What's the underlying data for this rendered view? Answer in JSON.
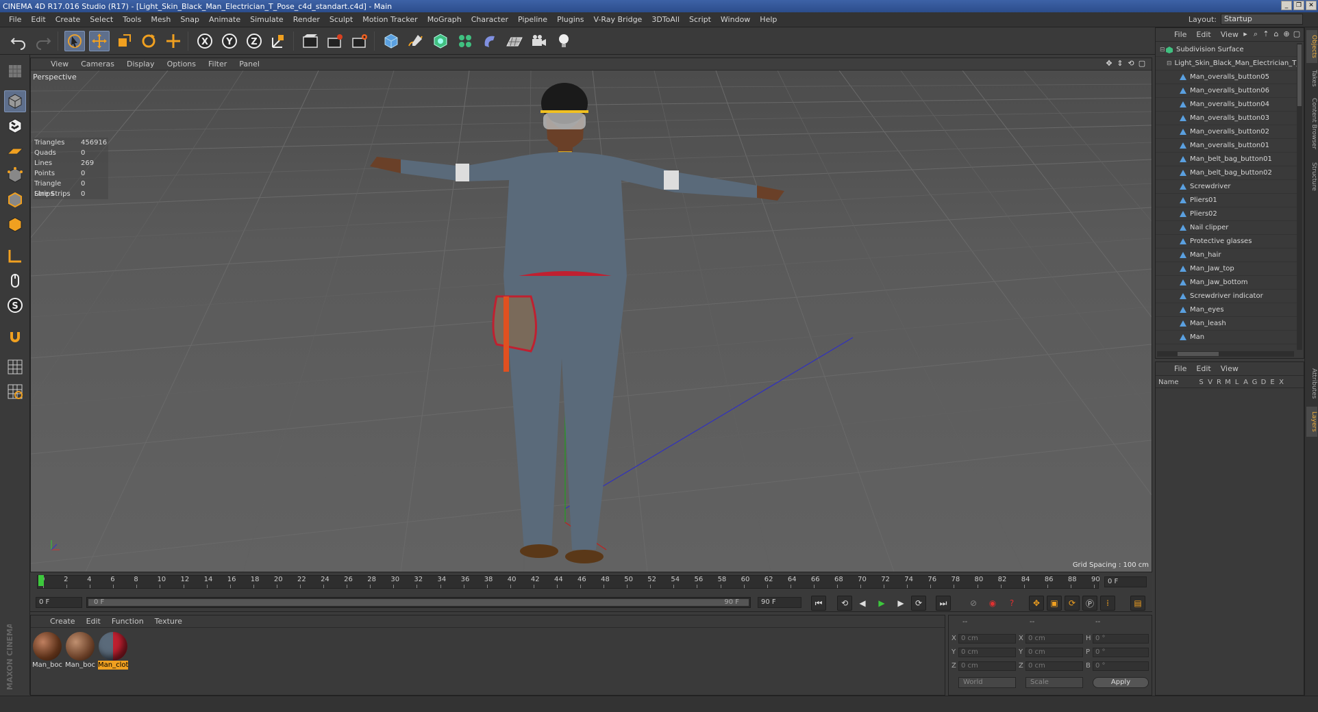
{
  "window": {
    "title": "CINEMA 4D R17.016 Studio (R17) - [Light_Skin_Black_Man_Electrician_T_Pose_c4d_standart.c4d] - Main",
    "controls": [
      "_",
      "❐",
      "✕"
    ]
  },
  "menubar": {
    "items": [
      "File",
      "Edit",
      "Create",
      "Select",
      "Tools",
      "Mesh",
      "Snap",
      "Animate",
      "Simulate",
      "Render",
      "Sculpt",
      "Motion Tracker",
      "MoGraph",
      "Character",
      "Pipeline",
      "Plugins",
      "V-Ray Bridge",
      "3DToAll",
      "Script",
      "Window",
      "Help"
    ],
    "layout_label": "Layout:",
    "layout_value": "Startup"
  },
  "toolbar": {
    "icons": [
      "undo-icon",
      "redo-icon",
      "live-selection-icon",
      "move-icon",
      "scale-icon",
      "rotate-icon",
      "recent-tools-icon",
      "x-axis-lock-icon",
      "y-axis-lock-icon",
      "z-axis-lock-icon",
      "coordinate-system-icon",
      "render-view-icon",
      "render-picture-viewer-icon",
      "edit-render-settings-icon",
      "cube-primitive-icon",
      "pen-spline-icon",
      "subdivision-surface-icon",
      "cloner-icon",
      "deformer-icon",
      "floor-scene-icon",
      "camera-icon",
      "light-icon"
    ]
  },
  "viewport": {
    "menu": [
      "View",
      "Cameras",
      "Display",
      "Options",
      "Filter",
      "Panel"
    ],
    "label": "Perspective",
    "stats": [
      {
        "k": "Triangles",
        "v": "456916"
      },
      {
        "k": "Quads",
        "v": "0"
      },
      {
        "k": "Lines",
        "v": "269"
      },
      {
        "k": "Points",
        "v": "0"
      },
      {
        "k": "Triangle Strips",
        "v": "0"
      },
      {
        "k": "Line Strips",
        "v": "0"
      }
    ],
    "grid_spacing": "Grid Spacing : 100 cm"
  },
  "timeline": {
    "ticks": [
      "0",
      "2",
      "4",
      "6",
      "8",
      "10",
      "12",
      "14",
      "16",
      "18",
      "20",
      "22",
      "24",
      "26",
      "28",
      "30",
      "32",
      "34",
      "36",
      "38",
      "40",
      "42",
      "44",
      "46",
      "48",
      "50",
      "52",
      "54",
      "56",
      "58",
      "60",
      "62",
      "64",
      "66",
      "68",
      "70",
      "72",
      "74",
      "76",
      "78",
      "80",
      "82",
      "84",
      "86",
      "88",
      "90"
    ],
    "current_frame": "0 F",
    "start": "0 F",
    "slider_start": "0 F",
    "slider_end": "90 F",
    "end": "90 F"
  },
  "materials": {
    "menu": [
      "Create",
      "Edit",
      "Function",
      "Texture"
    ],
    "items": [
      {
        "label": "Man_boc",
        "selected": false
      },
      {
        "label": "Man_boc",
        "selected": false
      },
      {
        "label": "Man_clot",
        "selected": true
      }
    ]
  },
  "coordinates": {
    "header": [
      "--",
      "--",
      "--"
    ],
    "rows": [
      {
        "a": "X",
        "av": "0 cm",
        "b": "X",
        "bv": "0 cm",
        "c": "H",
        "cv": "0 °"
      },
      {
        "a": "Y",
        "av": "0 cm",
        "b": "Y",
        "bv": "0 cm",
        "c": "P",
        "cv": "0 °"
      },
      {
        "a": "Z",
        "av": "0 cm",
        "b": "Z",
        "bv": "0 cm",
        "c": "B",
        "cv": "0 °"
      }
    ],
    "mode": "World",
    "scale": "Scale",
    "apply": "Apply"
  },
  "objects": {
    "menu": [
      "File",
      "Edit",
      "View"
    ],
    "tree": [
      {
        "label": "Subdivision Surface",
        "depth": 0,
        "type": "subd"
      },
      {
        "label": "Light_Skin_Black_Man_Electrician_T_Pose",
        "depth": 1,
        "type": "null"
      },
      {
        "label": "Man_overalls_button05",
        "depth": 2,
        "type": "poly"
      },
      {
        "label": "Man_overalls_button06",
        "depth": 2,
        "type": "poly"
      },
      {
        "label": "Man_overalls_button04",
        "depth": 2,
        "type": "poly"
      },
      {
        "label": "Man_overalls_button03",
        "depth": 2,
        "type": "poly"
      },
      {
        "label": "Man_overalls_button02",
        "depth": 2,
        "type": "poly"
      },
      {
        "label": "Man_overalls_button01",
        "depth": 2,
        "type": "poly"
      },
      {
        "label": "Man_belt_bag_button01",
        "depth": 2,
        "type": "poly"
      },
      {
        "label": "Man_belt_bag_button02",
        "depth": 2,
        "type": "poly"
      },
      {
        "label": "Screwdriver",
        "depth": 2,
        "type": "poly"
      },
      {
        "label": "Pliers01",
        "depth": 2,
        "type": "poly"
      },
      {
        "label": "Pliers02",
        "depth": 2,
        "type": "poly"
      },
      {
        "label": "Nail clipper",
        "depth": 2,
        "type": "poly"
      },
      {
        "label": "Protective glasses",
        "depth": 2,
        "type": "poly"
      },
      {
        "label": "Man_hair",
        "depth": 2,
        "type": "poly"
      },
      {
        "label": "Man_Jaw_top",
        "depth": 2,
        "type": "poly"
      },
      {
        "label": "Man_Jaw_bottom",
        "depth": 2,
        "type": "poly"
      },
      {
        "label": "Screwdriver indicator",
        "depth": 2,
        "type": "poly"
      },
      {
        "label": "Man_eyes",
        "depth": 2,
        "type": "poly"
      },
      {
        "label": "Man_leash",
        "depth": 2,
        "type": "poly"
      },
      {
        "label": "Man",
        "depth": 2,
        "type": "poly"
      }
    ]
  },
  "layers": {
    "menu": [
      "File",
      "Edit",
      "View"
    ],
    "name_col": "Name",
    "cols": [
      "S",
      "V",
      "R",
      "M",
      "L",
      "A",
      "G",
      "D",
      "E",
      "X"
    ]
  },
  "sidetabs": {
    "top": [
      "Objects",
      "Takes",
      "Content Browser",
      "Structure"
    ],
    "bottom": [
      "Attributes",
      "Layers"
    ]
  },
  "branding": {
    "text": "MAXON CINEMA 4D"
  },
  "colors": {
    "accent_orange": "#f0a020",
    "selection_blue": "#5e6f8c",
    "playhead_green": "#3cc83c"
  }
}
